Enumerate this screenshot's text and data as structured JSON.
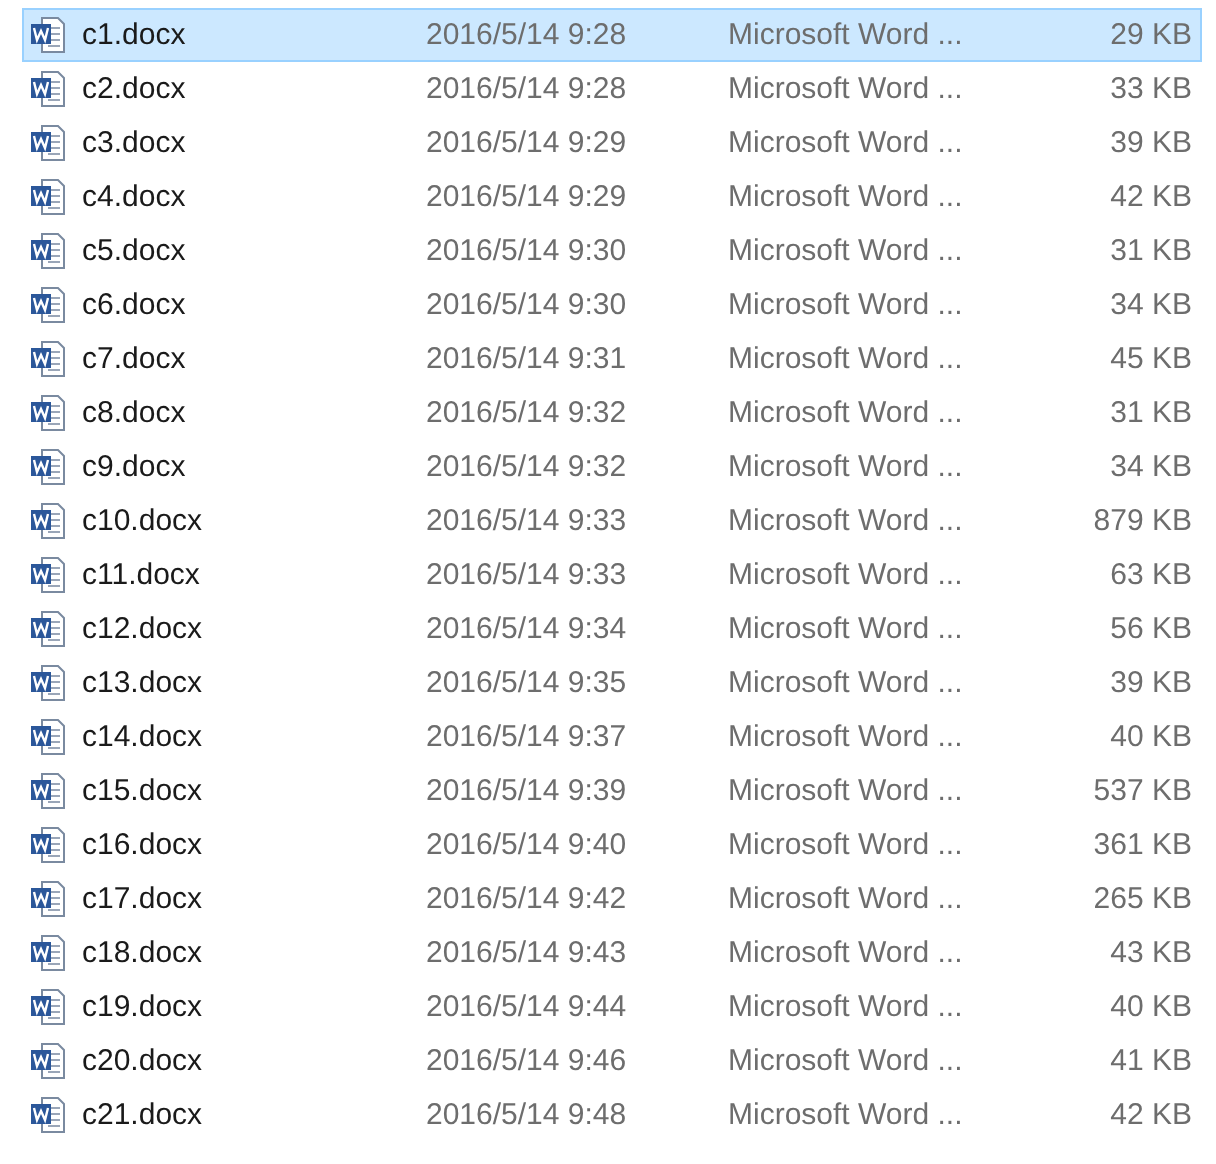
{
  "files": [
    {
      "name": "c1.docx",
      "date": "2016/5/14 9:28",
      "type": "Microsoft Word ...",
      "size": "29 KB",
      "selected": true
    },
    {
      "name": "c2.docx",
      "date": "2016/5/14 9:28",
      "type": "Microsoft Word ...",
      "size": "33 KB",
      "selected": false
    },
    {
      "name": "c3.docx",
      "date": "2016/5/14 9:29",
      "type": "Microsoft Word ...",
      "size": "39 KB",
      "selected": false
    },
    {
      "name": "c4.docx",
      "date": "2016/5/14 9:29",
      "type": "Microsoft Word ...",
      "size": "42 KB",
      "selected": false
    },
    {
      "name": "c5.docx",
      "date": "2016/5/14 9:30",
      "type": "Microsoft Word ...",
      "size": "31 KB",
      "selected": false
    },
    {
      "name": "c6.docx",
      "date": "2016/5/14 9:30",
      "type": "Microsoft Word ...",
      "size": "34 KB",
      "selected": false
    },
    {
      "name": "c7.docx",
      "date": "2016/5/14 9:31",
      "type": "Microsoft Word ...",
      "size": "45 KB",
      "selected": false
    },
    {
      "name": "c8.docx",
      "date": "2016/5/14 9:32",
      "type": "Microsoft Word ...",
      "size": "31 KB",
      "selected": false
    },
    {
      "name": "c9.docx",
      "date": "2016/5/14 9:32",
      "type": "Microsoft Word ...",
      "size": "34 KB",
      "selected": false
    },
    {
      "name": "c10.docx",
      "date": "2016/5/14 9:33",
      "type": "Microsoft Word ...",
      "size": "879 KB",
      "selected": false
    },
    {
      "name": "c11.docx",
      "date": "2016/5/14 9:33",
      "type": "Microsoft Word ...",
      "size": "63 KB",
      "selected": false
    },
    {
      "name": "c12.docx",
      "date": "2016/5/14 9:34",
      "type": "Microsoft Word ...",
      "size": "56 KB",
      "selected": false
    },
    {
      "name": "c13.docx",
      "date": "2016/5/14 9:35",
      "type": "Microsoft Word ...",
      "size": "39 KB",
      "selected": false
    },
    {
      "name": "c14.docx",
      "date": "2016/5/14 9:37",
      "type": "Microsoft Word ...",
      "size": "40 KB",
      "selected": false
    },
    {
      "name": "c15.docx",
      "date": "2016/5/14 9:39",
      "type": "Microsoft Word ...",
      "size": "537 KB",
      "selected": false
    },
    {
      "name": "c16.docx",
      "date": "2016/5/14 9:40",
      "type": "Microsoft Word ...",
      "size": "361 KB",
      "selected": false
    },
    {
      "name": "c17.docx",
      "date": "2016/5/14 9:42",
      "type": "Microsoft Word ...",
      "size": "265 KB",
      "selected": false
    },
    {
      "name": "c18.docx",
      "date": "2016/5/14 9:43",
      "type": "Microsoft Word ...",
      "size": "43 KB",
      "selected": false
    },
    {
      "name": "c19.docx",
      "date": "2016/5/14 9:44",
      "type": "Microsoft Word ...",
      "size": "40 KB",
      "selected": false
    },
    {
      "name": "c20.docx",
      "date": "2016/5/14 9:46",
      "type": "Microsoft Word ...",
      "size": "41 KB",
      "selected": false
    },
    {
      "name": "c21.docx",
      "date": "2016/5/14 9:48",
      "type": "Microsoft Word ...",
      "size": "42 KB",
      "selected": false
    }
  ]
}
